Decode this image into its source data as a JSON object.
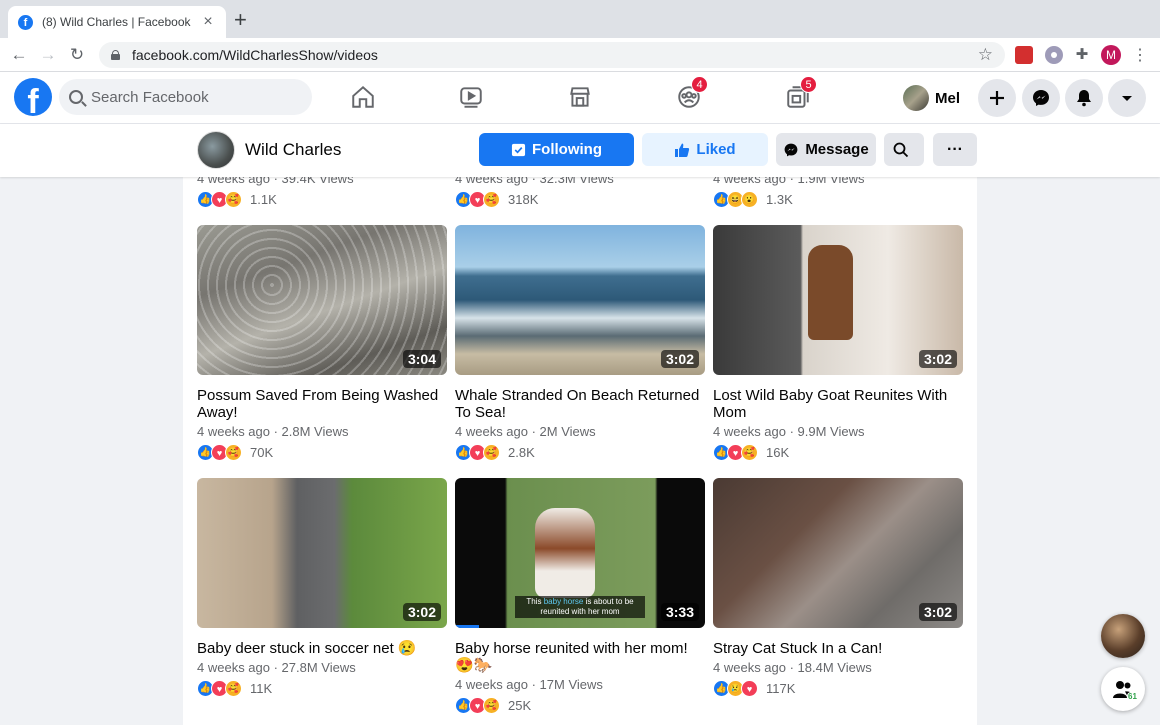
{
  "browser": {
    "tab_title": "(8) Wild Charles | Facebook",
    "tab_close": "×",
    "new_tab": "+",
    "url": "facebook.com/WildCharlesShow/videos",
    "profile_initial": "M"
  },
  "header": {
    "logo": "f",
    "search_placeholder": "Search Facebook",
    "groups_badge": "4",
    "gaming_badge": "5",
    "profile_name": "Mel"
  },
  "page": {
    "name": "Wild Charles",
    "following_label": "Following",
    "liked_label": "Liked",
    "message_label": "Message",
    "more_label": "···"
  },
  "videos_partial": [
    {
      "meta": "4 weeks ago · 39.4K Views",
      "reactions": "1.1K"
    },
    {
      "meta": "4 weeks ago · 32.3M Views",
      "reactions": "318K"
    },
    {
      "meta": "4 weeks ago · 1.9M Views",
      "reactions": "1.3K"
    }
  ],
  "videos": [
    {
      "title": "Possum Saved From Being Washed Away!",
      "duration": "3:04",
      "meta": "4 weeks ago · 2.8M Views",
      "reactions": "70K"
    },
    {
      "title": "Whale Stranded On Beach Returned To Sea!",
      "duration": "3:02",
      "meta": "4 weeks ago · 2M Views",
      "reactions": "2.8K"
    },
    {
      "title": "Lost Wild Baby Goat Reunites With Mom",
      "duration": "3:02",
      "meta": "4 weeks ago · 9.9M Views",
      "reactions": "16K"
    },
    {
      "title": "Baby deer stuck in soccer net 😢",
      "duration": "3:02",
      "meta": "4 weeks ago · 27.8M Views",
      "reactions": "11K"
    },
    {
      "title": "Baby horse reunited with her mom! 😍🐎",
      "duration": "3:33",
      "meta": "4 weeks ago · 17M Views",
      "reactions": "25K",
      "caption_pre": "This ",
      "caption_hl": "baby horse",
      "caption_post": " is about to be reunited with her mom"
    },
    {
      "title": "Stray Cat Stuck In a Can!",
      "duration": "3:02",
      "meta": "4 weeks ago · 18.4M Views",
      "reactions": "117K"
    }
  ],
  "contacts_count": "61",
  "colors": {
    "brand": "#1877f2",
    "badge": "#e41e3f"
  }
}
